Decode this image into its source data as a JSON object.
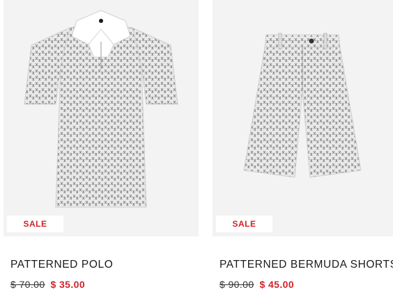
{
  "colors": {
    "sale": "#d2232a",
    "image_bg": "#f3f3f3",
    "text": "#1a1a1a"
  },
  "products": [
    {
      "name": "PATTERNED POLO",
      "badge": "SALE",
      "original_price": "$ 70.00",
      "sale_price": "$ 35.00",
      "image_icon": "polo-shirt-image"
    },
    {
      "name": "PATTERNED BERMUDA SHORTS",
      "badge": "SALE",
      "original_price": "$ 90.00",
      "sale_price": "$ 45.00",
      "image_icon": "bermuda-shorts-image"
    }
  ]
}
